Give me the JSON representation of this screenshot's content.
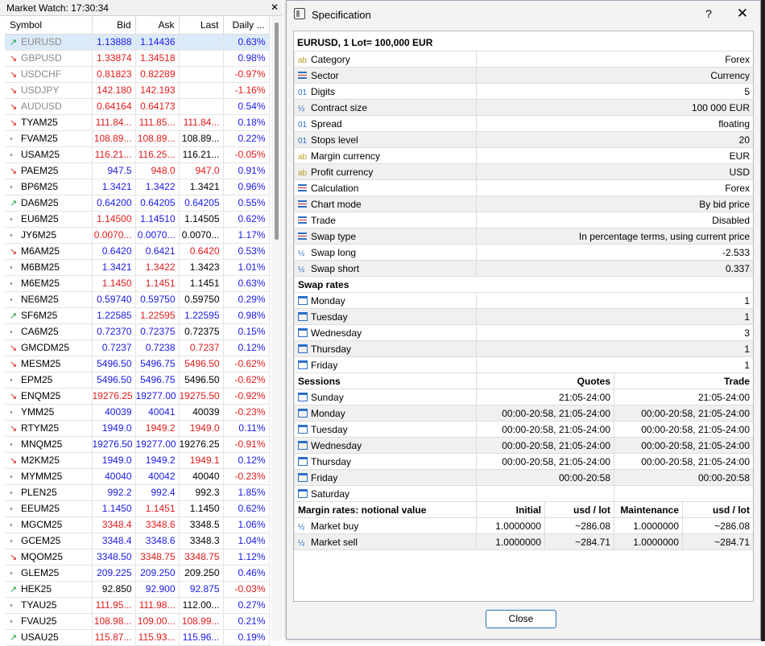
{
  "market_watch": {
    "title": "Market Watch: 17:30:34",
    "close_glyph": "✕",
    "columns": [
      "Symbol",
      "Bid",
      "Ask",
      "Last",
      "Daily ..."
    ],
    "rows": [
      {
        "dir": "up",
        "symbol": "EURUSD",
        "bid": "1.13888",
        "ask": "1.14436",
        "last": "",
        "daily": "0.63%",
        "bc": "blue",
        "ac": "blue",
        "lc": "blk",
        "dc": "blue",
        "fx": true,
        "sel": true
      },
      {
        "dir": "dn",
        "symbol": "GBPUSD",
        "bid": "1.33874",
        "ask": "1.34518",
        "last": "",
        "daily": "0.98%",
        "bc": "red",
        "ac": "red",
        "lc": "blk",
        "dc": "blue",
        "fx": true
      },
      {
        "dir": "dn",
        "symbol": "USDCHF",
        "bid": "0.81823",
        "ask": "0.82289",
        "last": "",
        "daily": "-0.97%",
        "bc": "red",
        "ac": "red",
        "lc": "blk",
        "dc": "red",
        "fx": true
      },
      {
        "dir": "dn",
        "symbol": "USDJPY",
        "bid": "142.180",
        "ask": "142.193",
        "last": "",
        "daily": "-1.16%",
        "bc": "red",
        "ac": "red",
        "lc": "blk",
        "dc": "red",
        "fx": true
      },
      {
        "dir": "dn",
        "symbol": "AUDUSD",
        "bid": "0.64164",
        "ask": "0.64173",
        "last": "",
        "daily": "0.54%",
        "bc": "red",
        "ac": "red",
        "lc": "blk",
        "dc": "blue",
        "fx": true
      },
      {
        "dir": "dn",
        "symbol": "TYAM25",
        "bid": "111.84...",
        "ask": "111.85...",
        "last": "111.84...",
        "daily": "0.18%",
        "bc": "red",
        "ac": "red",
        "lc": "red",
        "dc": "blue"
      },
      {
        "dir": "nt",
        "symbol": "FVAM25",
        "bid": "108.89...",
        "ask": "108.89...",
        "last": "108.89...",
        "daily": "0.22%",
        "bc": "red",
        "ac": "red",
        "lc": "blk",
        "dc": "blue"
      },
      {
        "dir": "nt",
        "symbol": "USAM25",
        "bid": "116.21...",
        "ask": "116.25...",
        "last": "116.21...",
        "daily": "-0.05%",
        "bc": "red",
        "ac": "red",
        "lc": "blk",
        "dc": "red"
      },
      {
        "dir": "dn",
        "symbol": "PAEM25",
        "bid": "947.5",
        "ask": "948.0",
        "last": "947.0",
        "daily": "0.91%",
        "bc": "blue",
        "ac": "red",
        "lc": "red",
        "dc": "blue"
      },
      {
        "dir": "nt",
        "symbol": "BP6M25",
        "bid": "1.3421",
        "ask": "1.3422",
        "last": "1.3421",
        "daily": "0.96%",
        "bc": "blue",
        "ac": "blue",
        "lc": "blk",
        "dc": "blue"
      },
      {
        "dir": "up",
        "symbol": "DA6M25",
        "bid": "0.64200",
        "ask": "0.64205",
        "last": "0.64205",
        "daily": "0.55%",
        "bc": "blue",
        "ac": "blue",
        "lc": "blue",
        "dc": "blue"
      },
      {
        "dir": "nt",
        "symbol": "EU6M25",
        "bid": "1.14500",
        "ask": "1.14510",
        "last": "1.14505",
        "daily": "0.62%",
        "bc": "red",
        "ac": "blue",
        "lc": "blk",
        "dc": "blue"
      },
      {
        "dir": "nt",
        "symbol": "JY6M25",
        "bid": "0.0070...",
        "ask": "0.0070...",
        "last": "0.0070...",
        "daily": "1.17%",
        "bc": "red",
        "ac": "blue",
        "lc": "blk",
        "dc": "blue"
      },
      {
        "dir": "dn",
        "symbol": "M6AM25",
        "bid": "0.6420",
        "ask": "0.6421",
        "last": "0.6420",
        "daily": "0.53%",
        "bc": "blue",
        "ac": "blue",
        "lc": "red",
        "dc": "blue"
      },
      {
        "dir": "nt",
        "symbol": "M6BM25",
        "bid": "1.3421",
        "ask": "1.3422",
        "last": "1.3423",
        "daily": "1.01%",
        "bc": "blue",
        "ac": "red",
        "lc": "blk",
        "dc": "blue"
      },
      {
        "dir": "nt",
        "symbol": "M6EM25",
        "bid": "1.1450",
        "ask": "1.1451",
        "last": "1.1451",
        "daily": "0.63%",
        "bc": "red",
        "ac": "red",
        "lc": "blk",
        "dc": "blue"
      },
      {
        "dir": "nt",
        "symbol": "NE6M25",
        "bid": "0.59740",
        "ask": "0.59750",
        "last": "0.59750",
        "daily": "0.29%",
        "bc": "blue",
        "ac": "blue",
        "lc": "blk",
        "dc": "blue"
      },
      {
        "dir": "up",
        "symbol": "SF6M25",
        "bid": "1.22585",
        "ask": "1.22595",
        "last": "1.22595",
        "daily": "0.98%",
        "bc": "blue",
        "ac": "red",
        "lc": "blue",
        "dc": "blue"
      },
      {
        "dir": "nt",
        "symbol": "CA6M25",
        "bid": "0.72370",
        "ask": "0.72375",
        "last": "0.72375",
        "daily": "0.15%",
        "bc": "blue",
        "ac": "blue",
        "lc": "blk",
        "dc": "blue"
      },
      {
        "dir": "dn",
        "symbol": "GMCDM25",
        "bid": "0.7237",
        "ask": "0.7238",
        "last": "0.7237",
        "daily": "0.12%",
        "bc": "blue",
        "ac": "blue",
        "lc": "red",
        "dc": "blue"
      },
      {
        "dir": "dn",
        "symbol": "MESM25",
        "bid": "5496.50",
        "ask": "5496.75",
        "last": "5496.50",
        "daily": "-0.62%",
        "bc": "blue",
        "ac": "blue",
        "lc": "red",
        "dc": "red"
      },
      {
        "dir": "nt",
        "symbol": "EPM25",
        "bid": "5496.50",
        "ask": "5496.75",
        "last": "5496.50",
        "daily": "-0.62%",
        "bc": "blue",
        "ac": "blue",
        "lc": "blk",
        "dc": "red"
      },
      {
        "dir": "dn",
        "symbol": "ENQM25",
        "bid": "19276.25",
        "ask": "19277.00",
        "last": "19275.50",
        "daily": "-0.92%",
        "bc": "red",
        "ac": "blue",
        "lc": "red",
        "dc": "red"
      },
      {
        "dir": "nt",
        "symbol": "YMM25",
        "bid": "40039",
        "ask": "40041",
        "last": "40039",
        "daily": "-0.23%",
        "bc": "blue",
        "ac": "blue",
        "lc": "blk",
        "dc": "red"
      },
      {
        "dir": "dn",
        "symbol": "RTYM25",
        "bid": "1949.0",
        "ask": "1949.2",
        "last": "1949.0",
        "daily": "0.11%",
        "bc": "blue",
        "ac": "red",
        "lc": "red",
        "dc": "blue"
      },
      {
        "dir": "nt",
        "symbol": "MNQM25",
        "bid": "19276.50",
        "ask": "19277.00",
        "last": "19276.25",
        "daily": "-0.91%",
        "bc": "blue",
        "ac": "blue",
        "lc": "blk",
        "dc": "red"
      },
      {
        "dir": "dn",
        "symbol": "M2KM25",
        "bid": "1949.0",
        "ask": "1949.2",
        "last": "1949.1",
        "daily": "0.12%",
        "bc": "blue",
        "ac": "blue",
        "lc": "red",
        "dc": "blue"
      },
      {
        "dir": "nt",
        "symbol": "MYMM25",
        "bid": "40040",
        "ask": "40042",
        "last": "40040",
        "daily": "-0.23%",
        "bc": "blue",
        "ac": "blue",
        "lc": "blk",
        "dc": "red"
      },
      {
        "dir": "nt",
        "symbol": "PLEN25",
        "bid": "992.2",
        "ask": "992.4",
        "last": "992.3",
        "daily": "1.85%",
        "bc": "blue",
        "ac": "blue",
        "lc": "blk",
        "dc": "blue"
      },
      {
        "dir": "nt",
        "symbol": "EEUM25",
        "bid": "1.1450",
        "ask": "1.1451",
        "last": "1.1450",
        "daily": "0.62%",
        "bc": "blue",
        "ac": "red",
        "lc": "blk",
        "dc": "blue"
      },
      {
        "dir": "nt",
        "symbol": "MGCM25",
        "bid": "3348.4",
        "ask": "3348.6",
        "last": "3348.5",
        "daily": "1.06%",
        "bc": "red",
        "ac": "red",
        "lc": "blk",
        "dc": "blue"
      },
      {
        "dir": "nt",
        "symbol": "GCEM25",
        "bid": "3348.4",
        "ask": "3348.6",
        "last": "3348.3",
        "daily": "1.04%",
        "bc": "blue",
        "ac": "blue",
        "lc": "blk",
        "dc": "blue"
      },
      {
        "dir": "dn",
        "symbol": "MQOM25",
        "bid": "3348.50",
        "ask": "3348.75",
        "last": "3348.75",
        "daily": "1.12%",
        "bc": "blue",
        "ac": "red",
        "lc": "red",
        "dc": "blue"
      },
      {
        "dir": "nt",
        "symbol": "GLEM25",
        "bid": "209.225",
        "ask": "209.250",
        "last": "209.250",
        "daily": "0.46%",
        "bc": "blue",
        "ac": "blue",
        "lc": "blk",
        "dc": "blue"
      },
      {
        "dir": "up",
        "symbol": "HEK25",
        "bid": "92.850",
        "ask": "92.900",
        "last": "92.875",
        "daily": "-0.03%",
        "bc": "blk",
        "ac": "blue",
        "lc": "blue",
        "dc": "red"
      },
      {
        "dir": "nt",
        "symbol": "TYAU25",
        "bid": "111.95...",
        "ask": "111.98...",
        "last": "112.00...",
        "daily": "0.27%",
        "bc": "red",
        "ac": "red",
        "lc": "blk",
        "dc": "blue"
      },
      {
        "dir": "nt",
        "symbol": "FVAU25",
        "bid": "108.98...",
        "ask": "109.00...",
        "last": "108.99...",
        "daily": "0.21%",
        "bc": "red",
        "ac": "red",
        "lc": "red",
        "dc": "blue"
      },
      {
        "dir": "up",
        "symbol": "USAU25",
        "bid": "115.87...",
        "ask": "115.93...",
        "last": "115.96...",
        "daily": "0.19%",
        "bc": "red",
        "ac": "red",
        "lc": "blue",
        "dc": "blue"
      }
    ]
  },
  "dialog": {
    "title": "Specification",
    "help_glyph": "?",
    "close_glyph": "✕",
    "header": "EURUSD, 1 Lot= 100,000 EUR",
    "props": [
      {
        "icon": "ab",
        "label": "Category",
        "value": "Forex"
      },
      {
        "icon": "lines",
        "label": "Sector",
        "value": "Currency"
      },
      {
        "icon": "01",
        "label": "Digits",
        "value": "5"
      },
      {
        "icon": "half",
        "label": "Contract size",
        "value": "100 000 EUR"
      },
      {
        "icon": "01",
        "label": "Spread",
        "value": "floating"
      },
      {
        "icon": "01",
        "label": "Stops level",
        "value": "20"
      },
      {
        "icon": "ab",
        "label": "Margin currency",
        "value": "EUR"
      },
      {
        "icon": "ab",
        "label": "Profit currency",
        "value": "USD"
      },
      {
        "icon": "lines",
        "label": "Calculation",
        "value": "Forex"
      },
      {
        "icon": "lines",
        "label": "Chart mode",
        "value": "By bid price"
      },
      {
        "icon": "lines",
        "label": "Trade",
        "value": "Disabled"
      },
      {
        "icon": "lines",
        "label": "Swap type",
        "value": "In percentage terms, using current price"
      },
      {
        "icon": "half",
        "label": "Swap long",
        "value": "-2.533"
      },
      {
        "icon": "half",
        "label": "Swap short",
        "value": "0.337"
      }
    ],
    "swap_rates_label": "Swap rates",
    "swap_rates": [
      {
        "day": "Monday",
        "value": "1"
      },
      {
        "day": "Tuesday",
        "value": "1"
      },
      {
        "day": "Wednesday",
        "value": "3"
      },
      {
        "day": "Thursday",
        "value": "1"
      },
      {
        "day": "Friday",
        "value": "1"
      }
    ],
    "sessions_label": "Sessions",
    "sessions_quotes_label": "Quotes",
    "sessions_trade_label": "Trade",
    "sessions": [
      {
        "day": "Sunday",
        "quotes": "21:05-24:00",
        "trade": "21:05-24:00"
      },
      {
        "day": "Monday",
        "quotes": "00:00-20:58, 21:05-24:00",
        "trade": "00:00-20:58, 21:05-24:00"
      },
      {
        "day": "Tuesday",
        "quotes": "00:00-20:58, 21:05-24:00",
        "trade": "00:00-20:58, 21:05-24:00"
      },
      {
        "day": "Wednesday",
        "quotes": "00:00-20:58, 21:05-24:00",
        "trade": "00:00-20:58, 21:05-24:00"
      },
      {
        "day": "Thursday",
        "quotes": "00:00-20:58, 21:05-24:00",
        "trade": "00:00-20:58, 21:05-24:00"
      },
      {
        "day": "Friday",
        "quotes": "00:00-20:58",
        "trade": "00:00-20:58"
      },
      {
        "day": "Saturday",
        "quotes": "",
        "trade": ""
      }
    ],
    "margin_label": "Margin rates: notional value",
    "margin_cols": [
      "Initial",
      "usd / lot",
      "Maintenance",
      "usd / lot"
    ],
    "margin_rows": [
      {
        "label": "Market buy",
        "initial": "1.0000000",
        "usd1": "~286.08",
        "maint": "1.0000000",
        "usd2": "~286.08"
      },
      {
        "label": "Market sell",
        "initial": "1.0000000",
        "usd1": "~284.71",
        "maint": "1.0000000",
        "usd2": "~284.71"
      }
    ],
    "close_button": "Close"
  }
}
